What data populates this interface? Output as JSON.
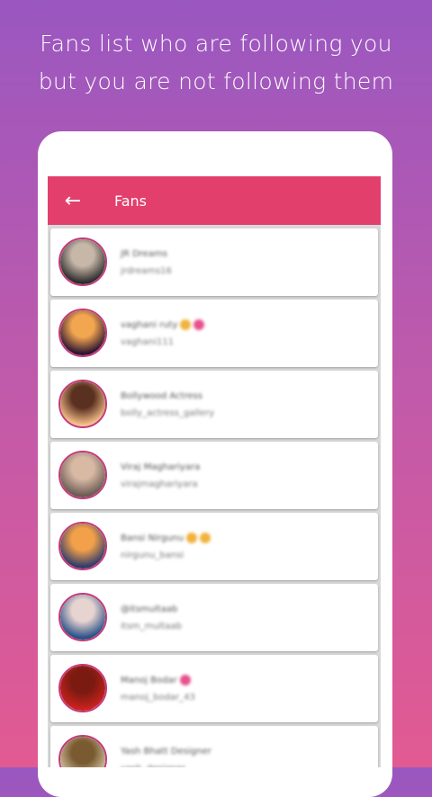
{
  "headline": {
    "line1": "Fans list who are following you",
    "line2": "but you are not following them"
  },
  "appbar": {
    "back_icon": "arrow-left-icon",
    "title": "Fans"
  },
  "fans": [
    {
      "name": "JR Dreams",
      "username": "jrdreams16",
      "avatar_colors": [
        "#2b2b2b",
        "#c7b7a8"
      ],
      "emojis": []
    },
    {
      "name": "vaghani ruty",
      "username": "vaghani111",
      "avatar_colors": [
        "#2a1330",
        "#f2a650"
      ],
      "emojis": [
        "#f0b33c",
        "#e8508e"
      ]
    },
    {
      "name": "Bollywood Actress",
      "username": "bolly_actress_gallery",
      "avatar_colors": [
        "#f7c08a",
        "#5a3020"
      ],
      "emojis": []
    },
    {
      "name": "Viraj Maghariyara",
      "username": "virajmaghariyara",
      "avatar_colors": [
        "#6b5a52",
        "#d7b9a4"
      ],
      "emojis": []
    },
    {
      "name": "Bansi Nirgunu",
      "username": "nirgunu_bansi",
      "avatar_colors": [
        "#2d3b6b",
        "#f2a04a"
      ],
      "emojis": [
        "#f0b33c",
        "#f0b33c"
      ]
    },
    {
      "name": "@itsmultaab",
      "username": "itsm_multaab",
      "avatar_colors": [
        "#274f86",
        "#e7d3cf"
      ],
      "emojis": []
    },
    {
      "name": "Manoj Bodar",
      "username": "manoj_bodar_43",
      "avatar_colors": [
        "#c9221e",
        "#7a1a10"
      ],
      "emojis": [
        "#e8508e"
      ]
    },
    {
      "name": "Yash Bhatt Designer",
      "username": "yash_designer",
      "avatar_colors": [
        "#d4c8a8",
        "#7a5a30"
      ],
      "emojis": []
    }
  ]
}
